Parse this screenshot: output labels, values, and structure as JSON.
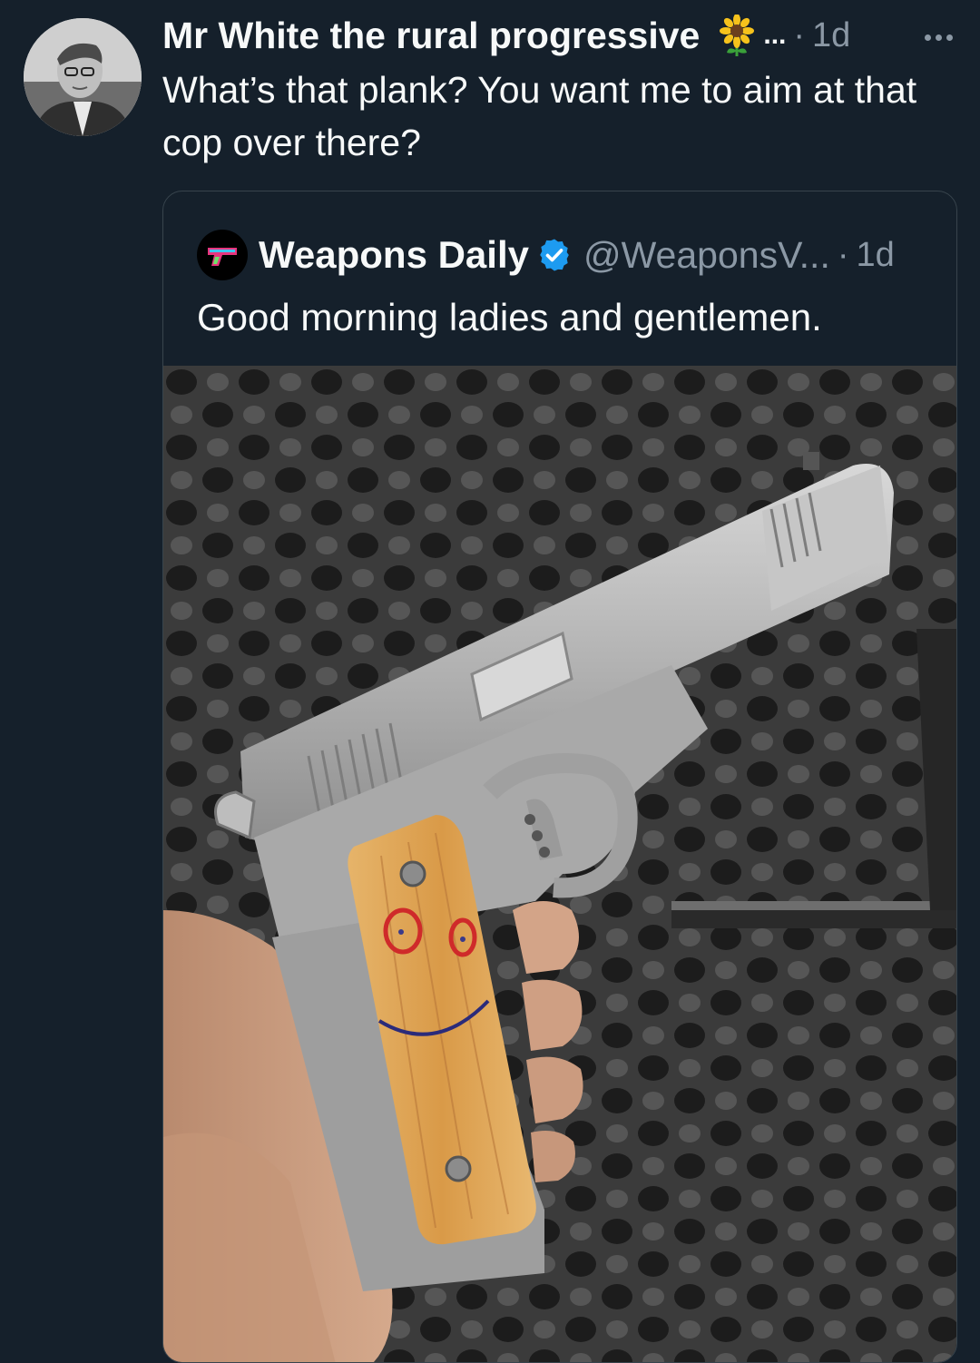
{
  "tweet": {
    "author_name": "Mr White the rural progressive",
    "emoji": "sunflower-icon",
    "truncation": "...",
    "separator": "·",
    "time": "1d",
    "text": "What’s that plank? You want me to aim at that cop over there?"
  },
  "quoted_tweet": {
    "author_name": "Weapons Daily",
    "verified": true,
    "handle": "@WeaponsV...",
    "separator": "·",
    "time": "1d",
    "text": "Good morning ladies and gentlemen."
  },
  "colors": {
    "background": "#15202b",
    "primary_text": "#f7f9f9",
    "secondary_text": "#8b98a5",
    "border": "#38444d",
    "verified_blue": "#1d9bf0"
  }
}
